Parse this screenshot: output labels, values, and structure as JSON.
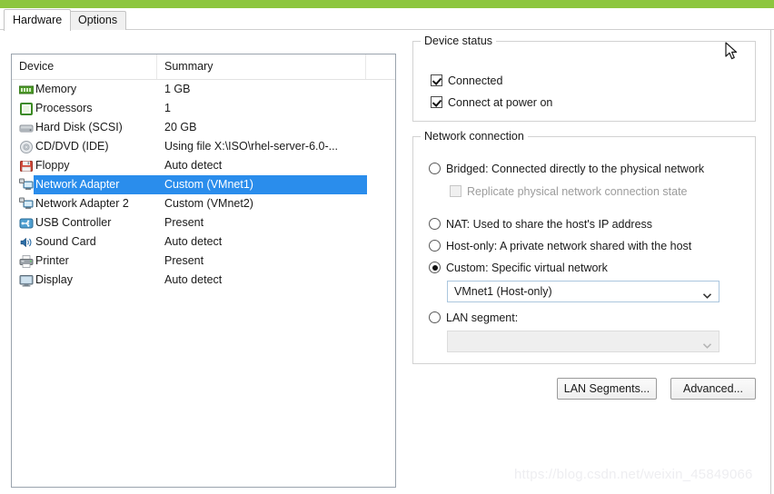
{
  "window": {
    "accent_color": "#8dc63f",
    "selection_color": "#2a8dec"
  },
  "tabs": [
    {
      "id": "hardware",
      "label": "Hardware",
      "active": true
    },
    {
      "id": "options",
      "label": "Options",
      "active": false
    }
  ],
  "device_list": {
    "columns": [
      {
        "id": "device",
        "label": "Device"
      },
      {
        "id": "summary",
        "label": "Summary"
      },
      {
        "id": "extra",
        "label": ""
      }
    ],
    "rows": [
      {
        "icon": "memory-icon",
        "name": "Memory",
        "summary": "1 GB",
        "selected": false
      },
      {
        "icon": "processor-icon",
        "name": "Processors",
        "summary": "1",
        "selected": false
      },
      {
        "icon": "hard-disk-icon",
        "name": "Hard Disk (SCSI)",
        "summary": "20 GB",
        "selected": false
      },
      {
        "icon": "cd-dvd-icon",
        "name": "CD/DVD (IDE)",
        "summary": "Using file X:\\ISO\\rhel-server-6.0-...",
        "selected": false
      },
      {
        "icon": "floppy-icon",
        "name": "Floppy",
        "summary": "Auto detect",
        "selected": false
      },
      {
        "icon": "network-adapter-icon",
        "name": "Network Adapter",
        "summary": "Custom (VMnet1)",
        "selected": true
      },
      {
        "icon": "network-adapter-icon",
        "name": "Network Adapter 2",
        "summary": "Custom (VMnet2)",
        "selected": false
      },
      {
        "icon": "usb-controller-icon",
        "name": "USB Controller",
        "summary": "Present",
        "selected": false
      },
      {
        "icon": "sound-card-icon",
        "name": "Sound Card",
        "summary": "Auto detect",
        "selected": false
      },
      {
        "icon": "printer-icon",
        "name": "Printer",
        "summary": "Present",
        "selected": false
      },
      {
        "icon": "display-icon",
        "name": "Display",
        "summary": "Auto detect",
        "selected": false
      }
    ]
  },
  "device_status": {
    "title": "Device status",
    "connected": {
      "label": "Connected",
      "checked": true
    },
    "connect_at_power_on": {
      "label": "Connect at power on",
      "checked": true
    }
  },
  "network_connection": {
    "title": "Network connection",
    "options": [
      {
        "id": "bridged",
        "label": "Bridged: Connected directly to the physical network",
        "selected": false
      },
      {
        "id": "nat",
        "label": "NAT: Used to share the host's IP address",
        "selected": false
      },
      {
        "id": "host-only",
        "label": "Host-only: A private network shared with the host",
        "selected": false
      },
      {
        "id": "custom",
        "label": "Custom: Specific virtual network",
        "selected": true
      },
      {
        "id": "lan",
        "label": "LAN segment:",
        "selected": false
      }
    ],
    "replicate_checkbox": {
      "label": "Replicate physical network connection state",
      "checked": false,
      "disabled": true
    },
    "custom_network_select": {
      "value": "VMnet1 (Host-only)",
      "disabled": false
    },
    "lan_segment_select": {
      "value": "",
      "disabled": true
    }
  },
  "buttons": {
    "lan_segments": "LAN Segments...",
    "advanced": "Advanced..."
  },
  "watermark": {
    "text": "https://blog.csdn.net/weixin_45849066"
  }
}
